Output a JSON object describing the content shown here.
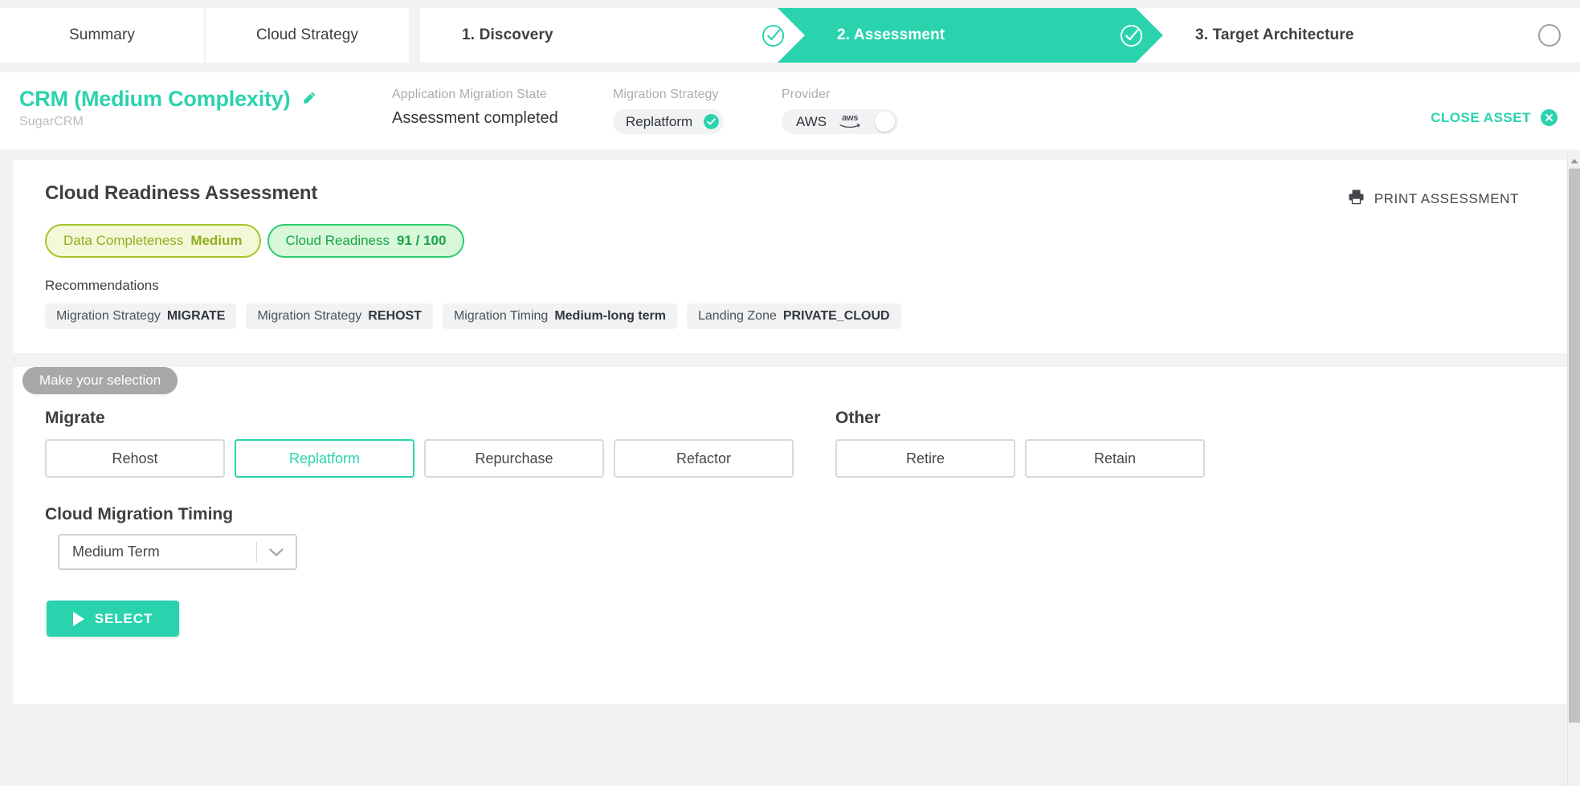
{
  "top_nav": {
    "tabs": [
      {
        "label": "Summary",
        "name": "tab-summary"
      },
      {
        "label": "Cloud Strategy",
        "name": "tab-cloud-strategy"
      }
    ]
  },
  "stepper": {
    "steps": [
      {
        "label": "1. Discovery",
        "state": "completed",
        "icon": "check-circle-icon"
      },
      {
        "label": "2. Assessment",
        "state": "active",
        "icon": "check-circle-icon"
      },
      {
        "label": "3. Target Architecture",
        "state": "pending",
        "icon": "empty-circle-icon"
      }
    ],
    "active_color": "#2ad3ae"
  },
  "asset_header": {
    "title": "CRM (Medium Complexity)",
    "edit_icon": "pencil-icon",
    "subtitle": "SugarCRM",
    "migration_state": {
      "label": "Application Migration State",
      "value": "Assessment completed"
    },
    "migration_strategy": {
      "label": "Migration Strategy",
      "value": "Replatform",
      "check_icon": "check-circle-filled-icon"
    },
    "provider": {
      "label": "Provider",
      "value": "AWS",
      "logo_text": "aws",
      "toggle_state": "on"
    },
    "close_asset": {
      "label": "CLOSE ASSET",
      "icon": "close-circle-icon"
    }
  },
  "assessment": {
    "title": "Cloud Readiness Assessment",
    "print": {
      "label": "PRINT ASSESSMENT",
      "icon": "printer-icon"
    },
    "badges": [
      {
        "name": "Data Completeness",
        "value": "Medium",
        "color": "#8fae1f"
      },
      {
        "name": "Cloud Readiness",
        "value": "91 / 100",
        "color": "#17a54a"
      }
    ],
    "recommendations_title": "Recommendations",
    "recommendations": [
      {
        "name": "Migration Strategy",
        "value": "MIGRATE"
      },
      {
        "name": "Migration Strategy",
        "value": "REHOST"
      },
      {
        "name": "Migration Timing",
        "value": "Medium-long term"
      },
      {
        "name": "Landing Zone",
        "value": "PRIVATE_CLOUD"
      }
    ]
  },
  "selection": {
    "tab_label": "Make your selection",
    "groups": [
      {
        "title": "Migrate",
        "options": [
          {
            "label": "Rehost",
            "selected": false
          },
          {
            "label": "Replatform",
            "selected": true
          },
          {
            "label": "Repurchase",
            "selected": false
          },
          {
            "label": "Refactor",
            "selected": false
          }
        ]
      },
      {
        "title": "Other",
        "options": [
          {
            "label": "Retire",
            "selected": false
          },
          {
            "label": "Retain",
            "selected": false
          }
        ]
      }
    ],
    "timing": {
      "title": "Cloud Migration Timing",
      "value": "Medium Term",
      "dropdown_icon": "chevron-down-icon"
    },
    "submit": {
      "label": "SELECT",
      "icon": "play-icon"
    }
  }
}
